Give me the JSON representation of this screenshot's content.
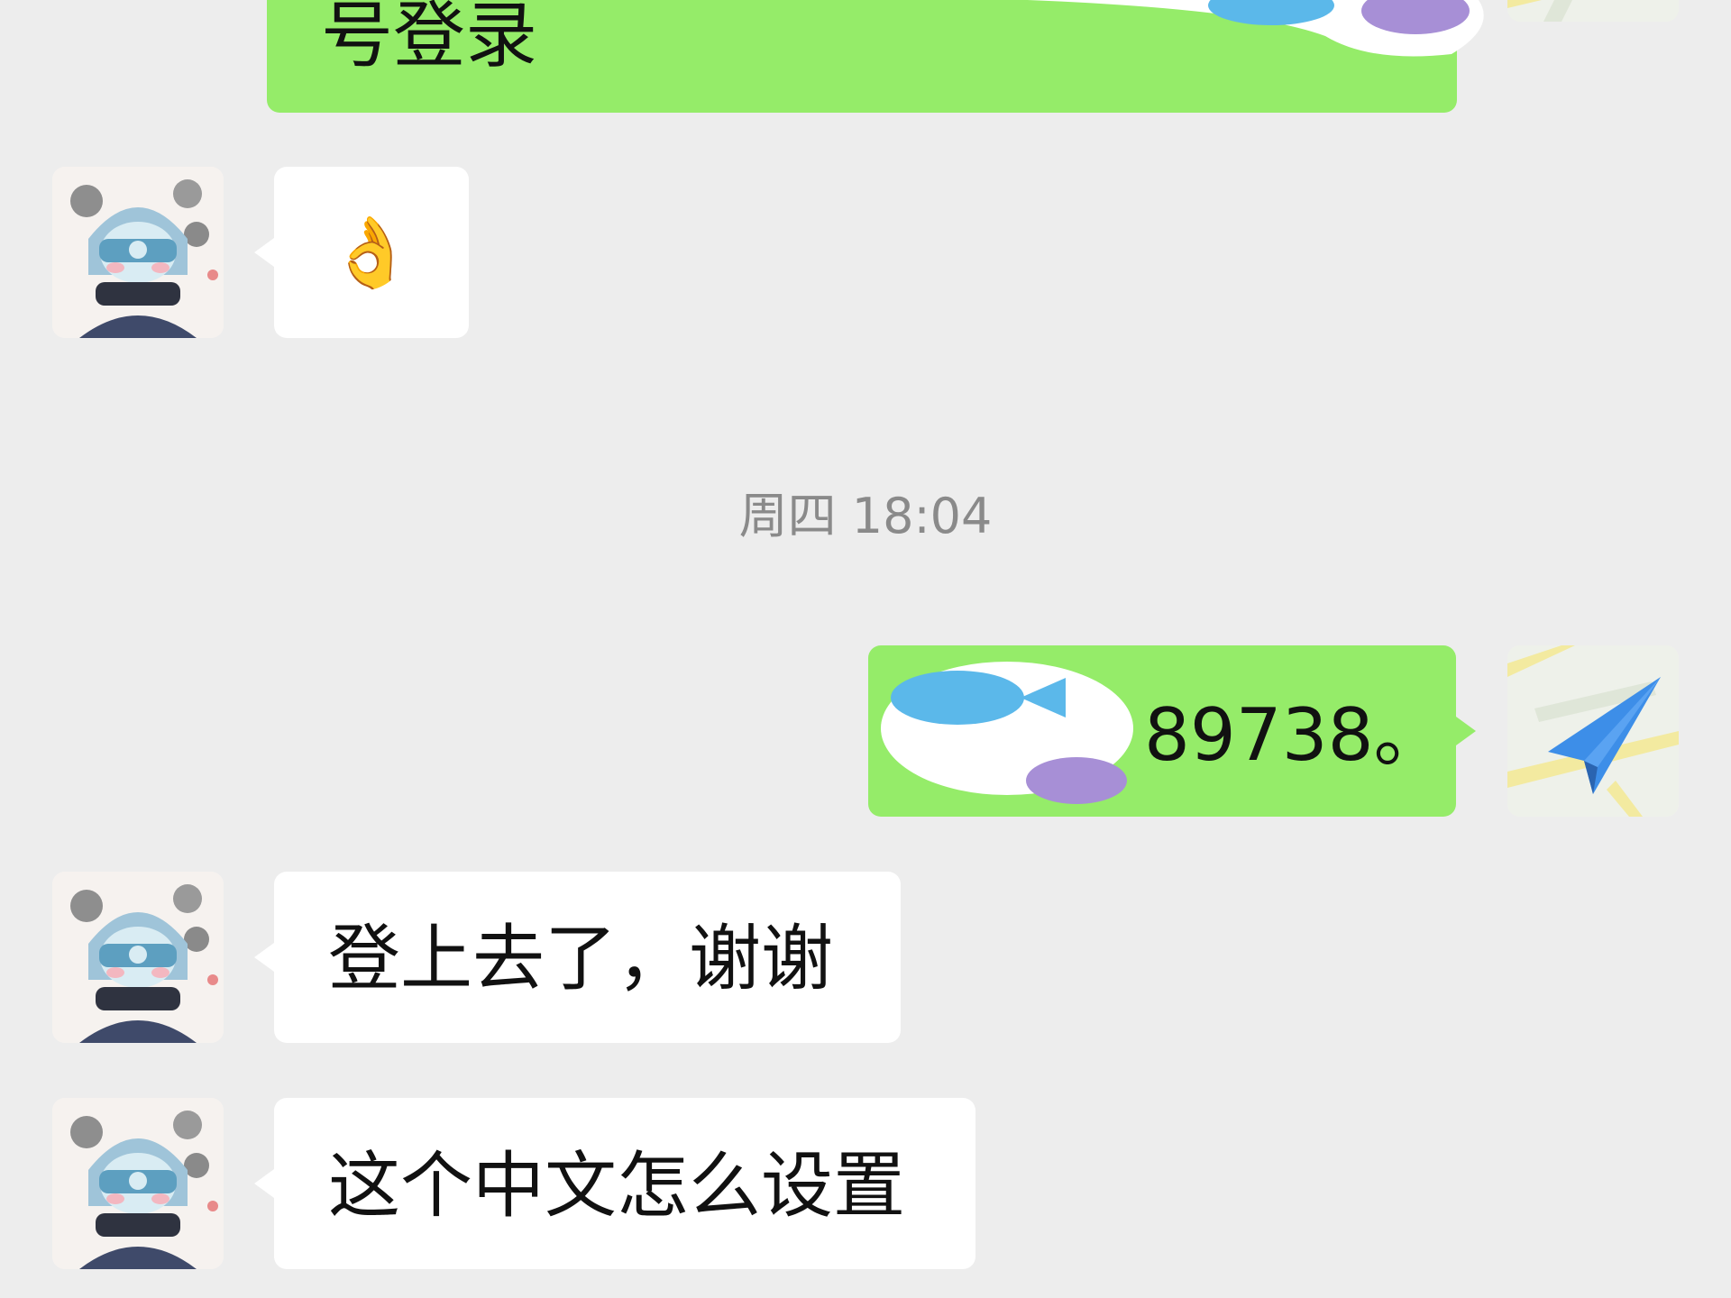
{
  "chat": {
    "messages": [
      {
        "sender": "self",
        "text": "号登录"
      },
      {
        "sender": "contact",
        "emoji": "👌"
      },
      {
        "sender": "self",
        "text": "89738。"
      },
      {
        "sender": "contact",
        "text": "登上去了，谢谢"
      },
      {
        "sender": "contact",
        "text": "这个中文怎么设置"
      }
    ],
    "timestamp": "周四 18:04"
  },
  "colors": {
    "background": "#ededed",
    "outgoing_bubble": "#95ec69",
    "incoming_bubble": "#ffffff",
    "timestamp_text": "#8a8a8a"
  },
  "icons": {
    "self_avatar": "paper-plane-map-icon",
    "contact_avatar": "anime-character-avatar"
  }
}
